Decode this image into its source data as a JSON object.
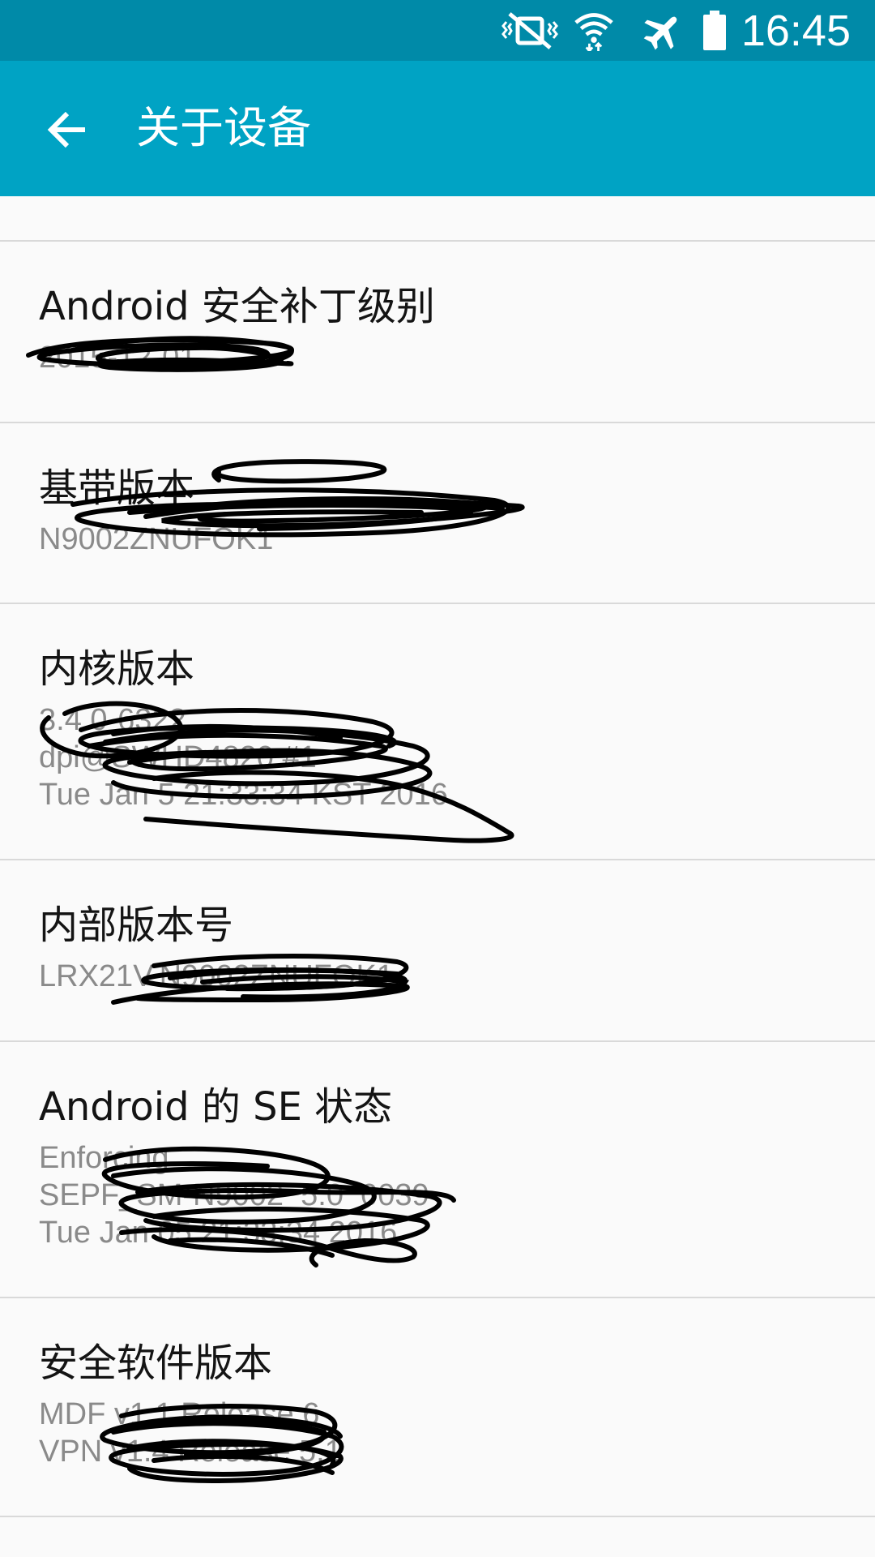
{
  "status_bar": {
    "time": "16:45",
    "icons": [
      "vibrate-mute-icon",
      "wifi-icon",
      "airplane-mode-icon",
      "battery-icon"
    ]
  },
  "app_bar": {
    "back_icon": "arrow-back-icon",
    "title": "关于设备"
  },
  "items": [
    {
      "title": "Android 安全补丁级别",
      "value": "2015-12-01"
    },
    {
      "title": "基带版本",
      "value": "N9002ZNUFOK1"
    },
    {
      "title": "内核版本",
      "value": "3.4.0-6322\ndpi@SWHD4820 #1\nTue Jan 5 21:33:34 KST 2016"
    },
    {
      "title": "内部版本号",
      "value": "LRX21V.N9002ZNUFOK1"
    },
    {
      "title": "Android 的 SE 状态",
      "value": "Enforcing\nSEPF_SM-N9002_5.0_0039\nTue Jan 05 21:33:34 2016"
    },
    {
      "title": "安全软件版本",
      "value": "MDF v1.1 Release 6\nVPN v1.4 Release 5.1"
    }
  ],
  "colors": {
    "status_bar": "#008aa8",
    "app_bar": "#00a3c4",
    "background": "#fafafa",
    "title_text": "#141414",
    "secondary_text": "#8a8a8a",
    "divider": "#d9d9d9"
  }
}
